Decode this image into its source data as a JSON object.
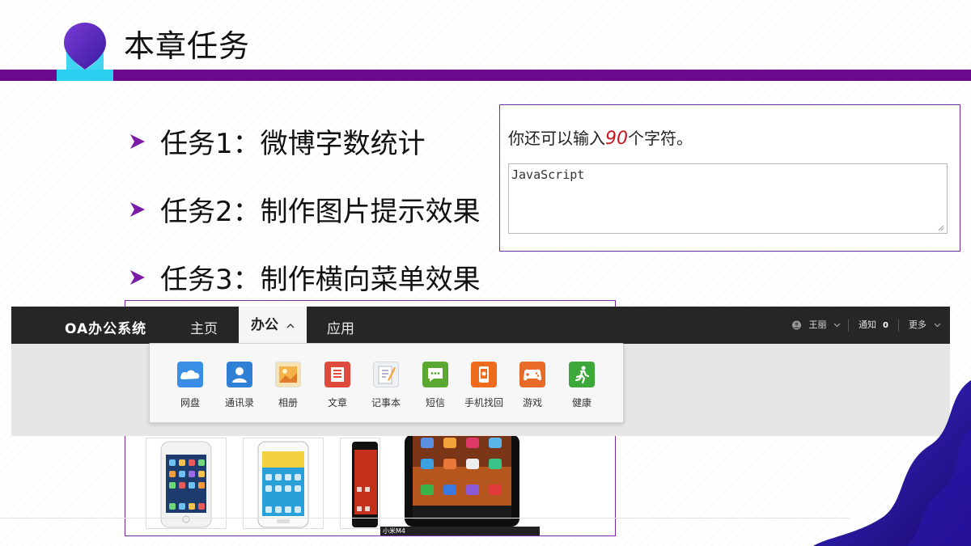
{
  "slide": {
    "title": "本章任务",
    "tasks": [
      {
        "label": "任务1：微博字数统计"
      },
      {
        "label": "任务2：制作图片提示效果"
      },
      {
        "label": "任务3：制作横向菜单效果"
      }
    ]
  },
  "counter_demo": {
    "prefix": "你还可以输入",
    "count": "90",
    "suffix": "个字符。",
    "textarea_value": "JavaScript"
  },
  "oa_system": {
    "brand": "OA办公系统",
    "nav": [
      {
        "label": "主页"
      },
      {
        "label": "办公"
      },
      {
        "label": "应用"
      }
    ],
    "active_chevron": "^",
    "user_name": "王丽",
    "notifications_label": "通知",
    "notifications_count": "0",
    "more_label": "更多",
    "apps": [
      {
        "label": "网盘",
        "icon": "cloud-drive-icon",
        "color": "#3a8ee6"
      },
      {
        "label": "通讯录",
        "icon": "contacts-icon",
        "color": "#2f7fd6"
      },
      {
        "label": "相册",
        "icon": "photo-album-icon",
        "color": "#e8a33a"
      },
      {
        "label": "文章",
        "icon": "article-icon",
        "color": "#e04a3c"
      },
      {
        "label": "记事本",
        "icon": "notepad-icon",
        "color": "#dfe3e8"
      },
      {
        "label": "短信",
        "icon": "sms-icon",
        "color": "#5aa832"
      },
      {
        "label": "手机找回",
        "icon": "phone-finder-icon",
        "color": "#ee6b1e"
      },
      {
        "label": "游戏",
        "icon": "gamepad-icon",
        "color": "#e86a28"
      },
      {
        "label": "健康",
        "icon": "health-icon",
        "color": "#3ca83a"
      }
    ]
  },
  "phone_gallery": {
    "large_caption": "小米M4"
  },
  "colors": {
    "brand_purple": "#6a0a8f",
    "accent_cyan": "#2bd0f0",
    "counter_red": "#c8141e"
  }
}
